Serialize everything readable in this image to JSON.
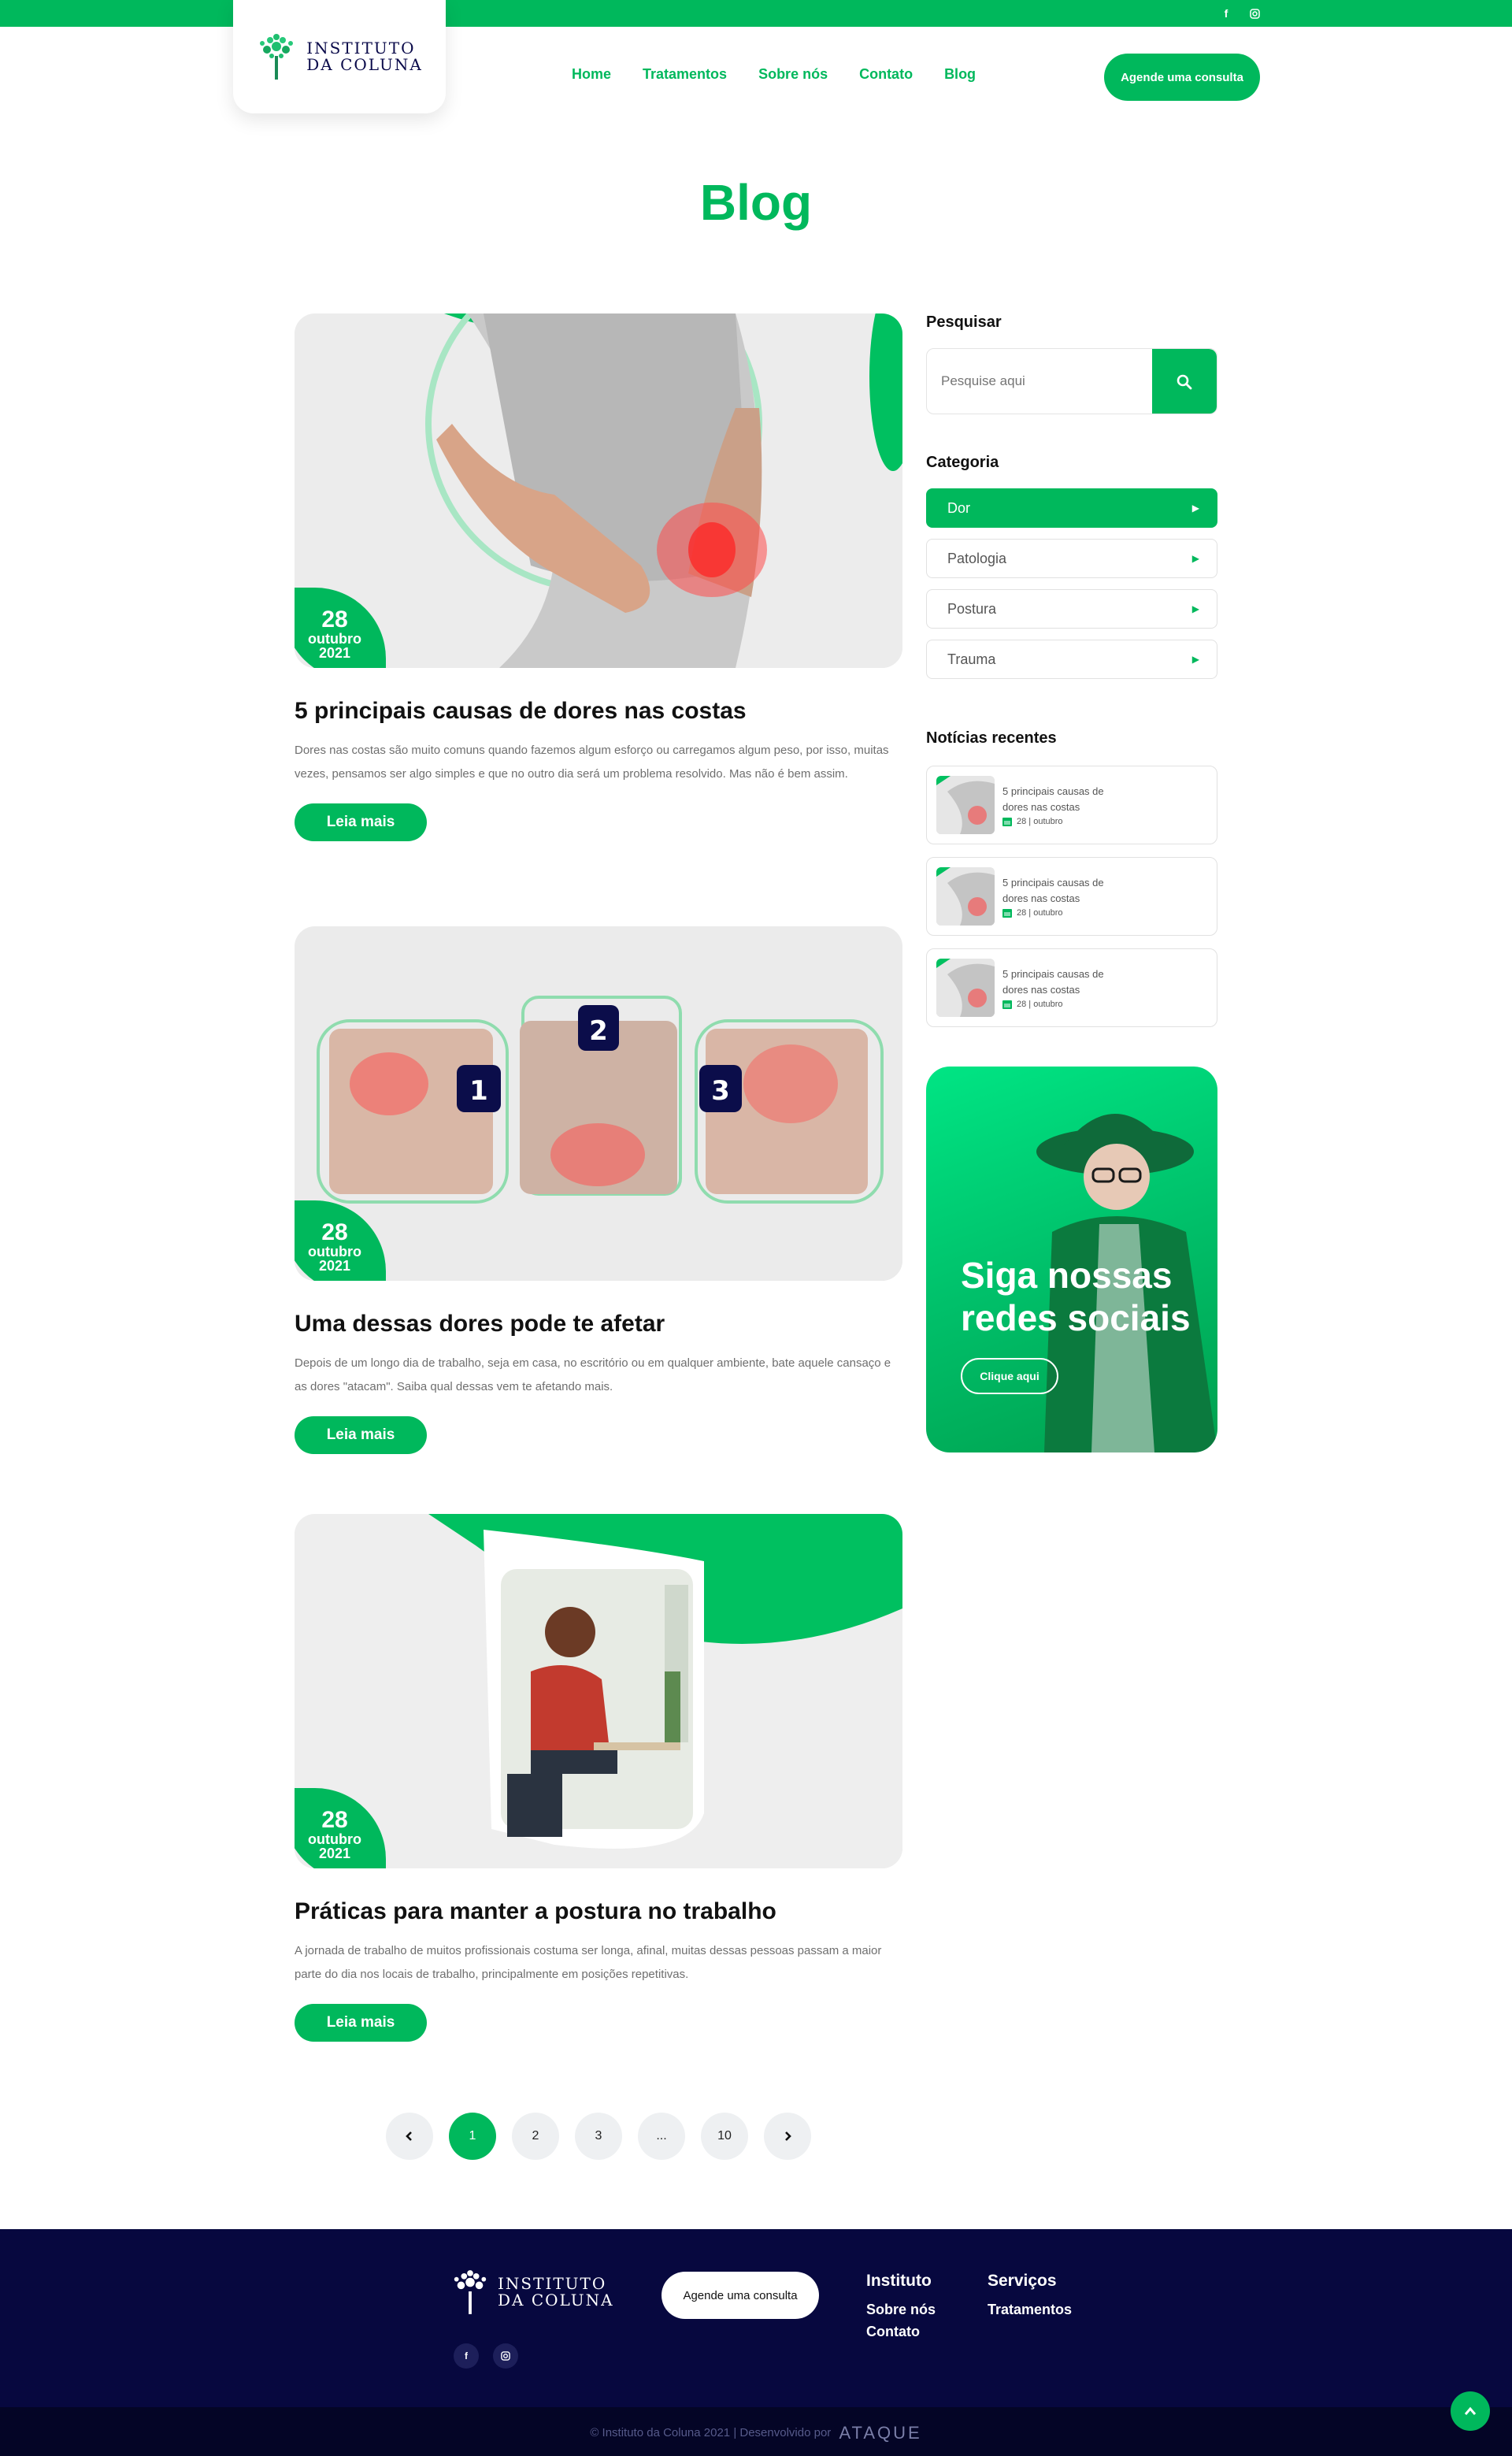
{
  "header": {
    "logo_line1": "INSTITUTO",
    "logo_line2": "DA COLUNA",
    "nav": [
      "Home",
      "Tratamentos",
      "Sobre nós",
      "Contato",
      "Blog"
    ],
    "cta": "Agende uma consulta",
    "social": [
      "facebook-icon",
      "instagram-icon"
    ]
  },
  "page": {
    "title": "Blog"
  },
  "posts": [
    {
      "day": "28",
      "month": "outubro",
      "year": "2021",
      "title": "5 principais causas de dores nas costas",
      "excerpt": "Dores nas costas são muito comuns quando fazemos algum esforço ou carregamos algum peso, por isso, muitas vezes, pensamos ser algo simples e que no outro dia será um problema resolvido. Mas não é bem assim.",
      "read_more": "Leia mais"
    },
    {
      "day": "28",
      "month": "outubro",
      "year": "2021",
      "title": "Uma dessas dores pode te afetar",
      "excerpt": "Depois de um longo dia de trabalho, seja em casa, no escritório ou em qualquer ambiente, bate aquele cansaço e as dores \"atacam\". Saiba qual dessas vem te afetando mais.",
      "read_more": "Leia mais",
      "image_numbers": [
        "1",
        "2",
        "3"
      ]
    },
    {
      "day": "28",
      "month": "outubro",
      "year": "2021",
      "title": "Práticas para manter a postura no trabalho",
      "excerpt": "A jornada de trabalho de muitos profissionais costuma ser longa, afinal, muitas dessas pessoas passam a maior parte do dia nos locais de trabalho, principalmente em posições repetitivas.",
      "read_more": "Leia mais"
    }
  ],
  "sidebar": {
    "search_label": "Pesquisar",
    "search_placeholder": "Pesquise aqui",
    "category_label": "Categoria",
    "categories": [
      "Dor",
      "Patologia",
      "Postura",
      "Trauma"
    ],
    "active_category": "Dor",
    "recent_label": "Notícias recentes",
    "recent": [
      {
        "title": "5 principais causas de dores nas costas",
        "date": "28 | outubro"
      },
      {
        "title": "5 principais causas de dores nas costas",
        "date": "28 | outubro"
      },
      {
        "title": "5 principais causas de dores nas costas",
        "date": "28 | outubro"
      }
    ],
    "social_card": {
      "headline": "Siga nossas redes sociais",
      "button": "Clique aqui"
    }
  },
  "pagination": {
    "pages": [
      "1",
      "2",
      "3",
      "...",
      "10"
    ],
    "current": "1"
  },
  "footer": {
    "logo_line1": "INSTITUTO",
    "logo_line2": "DA COLUNA",
    "cta": "Agende uma consulta",
    "col1_title": "Instituto",
    "col1_links": [
      "Sobre nós",
      "Contato"
    ],
    "col2_title": "Serviços",
    "col2_links": [
      "Tratamentos"
    ],
    "copyright": "© Instituto da Coluna 2021 | Desenvolvido por",
    "developer": "ATAQUE"
  },
  "colors": {
    "brand_green": "#00b85c",
    "footer_navy": "#07083f"
  }
}
